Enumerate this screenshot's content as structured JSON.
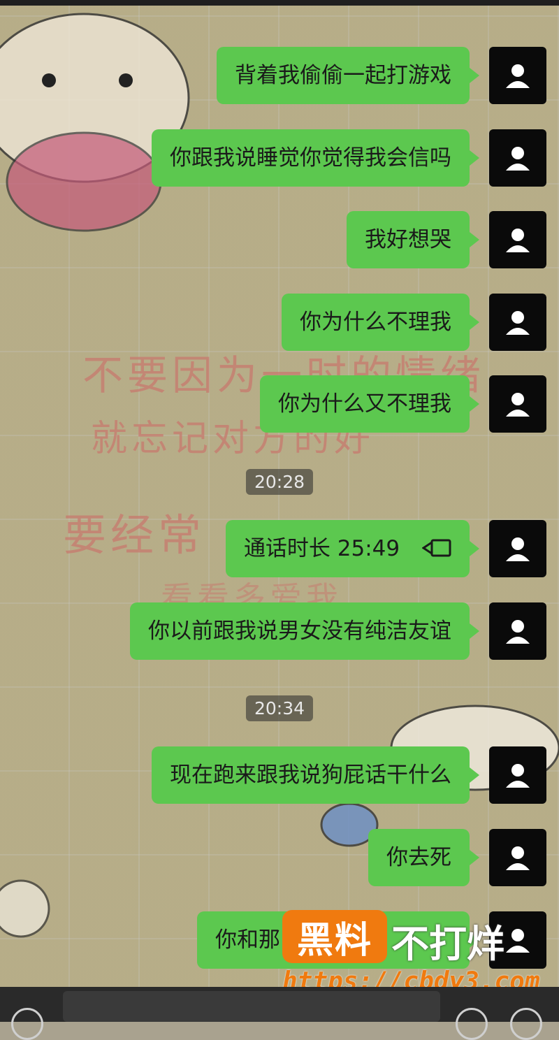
{
  "wallpaper": {
    "lines": [
      "不要因为一时的情绪",
      "就忘记对方的好",
      "要经常",
      "看看多爱我"
    ]
  },
  "messages": [
    {
      "text": "背着我偷偷一起打游戏"
    },
    {
      "text": "你跟我说睡觉你觉得我会信吗"
    },
    {
      "text": "我好想哭"
    },
    {
      "text": "你为什么不理我"
    },
    {
      "text": "你为什么又不理我"
    },
    {
      "time": "20:28"
    },
    {
      "text": "通话时长 25:49",
      "call": true
    },
    {
      "text": "你以前跟我说男女没有纯洁友谊"
    },
    {
      "time": "20:34"
    },
    {
      "text": "现在跑来跟我说狗屁话干什么"
    },
    {
      "text": "你去死"
    },
    {
      "text": "你和那"
    }
  ],
  "watermark": {
    "tag": "黑料",
    "slogan": "不打烊",
    "url": "https://cbdy3.com"
  },
  "colors": {
    "bubble": "#5cc84f",
    "avatar_bg": "#0a0a0a",
    "watermark_orange": "#f07a0f"
  },
  "icons": {
    "avatar": "default-user-icon",
    "call": "video-call-icon",
    "voice": "voice-icon",
    "emoji": "emoji-icon",
    "add": "plus-icon"
  }
}
